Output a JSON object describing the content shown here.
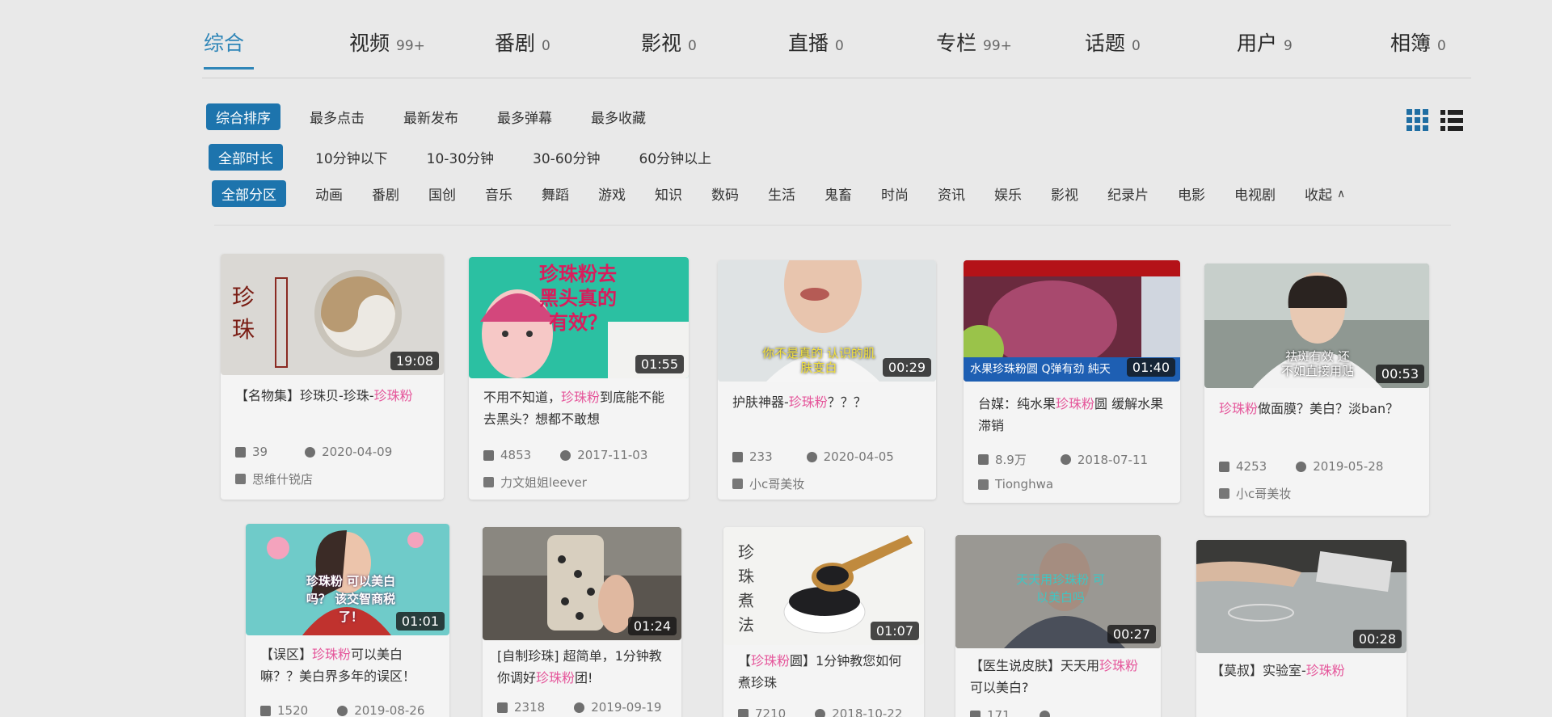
{
  "tabs": [
    {
      "label": "综合",
      "count": ""
    },
    {
      "label": "视频",
      "count": "99+"
    },
    {
      "label": "番剧",
      "count": "0"
    },
    {
      "label": "影视",
      "count": "0"
    },
    {
      "label": "直播",
      "count": "0"
    },
    {
      "label": "专栏",
      "count": "99+"
    },
    {
      "label": "话题",
      "count": "0"
    },
    {
      "label": "用户",
      "count": "9"
    },
    {
      "label": "相簿",
      "count": "0"
    }
  ],
  "sort": {
    "active": "综合排序",
    "options": [
      "最多点击",
      "最新发布",
      "最多弹幕",
      "最多收藏"
    ]
  },
  "duration": {
    "active": "全部时长",
    "options": [
      "10分钟以下",
      "10-30分钟",
      "30-60分钟",
      "60分钟以上"
    ]
  },
  "zone": {
    "active": "全部分区",
    "options": [
      "动画",
      "番剧",
      "国创",
      "音乐",
      "舞蹈",
      "游戏",
      "知识",
      "数码",
      "生活",
      "鬼畜",
      "时尚",
      "资讯",
      "娱乐",
      "影视",
      "纪录片",
      "电影",
      "电视剧"
    ],
    "collapse": "收起",
    "collapse_icon": "chevron-up-icon"
  },
  "view_toggle": {
    "grid_icon": "grid-view-icon",
    "list_icon": "list-view-icon"
  },
  "highlight_color": "#e5559a",
  "accent_color": "#1d74ad",
  "videos": [
    {
      "title_pre": "【名物集】珍珠贝-珍珠-",
      "title_hl": "珍珠粉",
      "title_post": "",
      "duration": "19:08",
      "plays": "39",
      "date": "2020-04-09",
      "author": "思维什锐店",
      "thumb_text": "珍 珠"
    },
    {
      "title_pre": "不用不知道，",
      "title_hl": "珍珠粉",
      "title_post": "到底能不能去黑头？想都不敢想",
      "duration": "01:55",
      "plays": "4853",
      "date": "2017-11-03",
      "author": "力文姐姐leever",
      "thumb_text": "珍珠粉去黑头真的有效？"
    },
    {
      "title_pre": "护肤神器-",
      "title_hl": "珍珠粉",
      "title_post": "？？？",
      "duration": "00:29",
      "plays": "233",
      "date": "2020-04-05",
      "author": "小c哥美妆",
      "thumb_text": "你不是真的 认识的肌肤变白"
    },
    {
      "title_pre": "台媒：纯水果",
      "title_hl": "珍珠粉",
      "title_post": "圆 缓解水果滞销",
      "duration": "01:40",
      "plays": "8.9万",
      "date": "2018-07-11",
      "author": "Tionghwa",
      "thumb_text": "水果珍珠粉圆 Q弹有劲 純天"
    },
    {
      "title_pre": "",
      "title_hl": "珍珠粉",
      "title_post": "做面膜？美白？淡ban？",
      "duration": "00:53",
      "plays": "4253",
      "date": "2019-05-28",
      "author": "小c哥美妆",
      "thumb_text": "祛斑有效 还不如直接用贴"
    },
    {
      "title_pre": "【误区】",
      "title_hl": "珍珠粉",
      "title_post": "可以美白嘛？？美白界多年的误区！",
      "duration": "01:01",
      "plays": "1520",
      "date": "2019-08-26",
      "author": "",
      "thumb_text": "珍珠粉 可以美白吗？ 该交智商税了！"
    },
    {
      "title_pre": "[自制珍珠] 超简单，1分钟教你调好",
      "title_hl": "珍珠粉",
      "title_post": "团!",
      "duration": "01:24",
      "plays": "2318",
      "date": "2019-09-19",
      "author": "",
      "thumb_text": ""
    },
    {
      "title_pre": "【",
      "title_hl": "珍珠粉",
      "title_post": "圆】1分钟教您如何煮珍珠",
      "duration": "01:07",
      "plays": "7210",
      "date": "2018-10-22",
      "author": "",
      "thumb_text": "珍 珠 煮 法"
    },
    {
      "title_pre": "【医生说皮肤】天天用",
      "title_hl": "珍珠粉",
      "title_post": "可以美白?",
      "duration": "00:27",
      "plays": "171",
      "date": "",
      "author": "",
      "thumb_text": "天天用珍珠粉 可以美白吗"
    },
    {
      "title_pre": "【莫叔】实验室-",
      "title_hl": "珍珠粉",
      "title_post": "",
      "duration": "00:28",
      "plays": "",
      "date": "",
      "author": "",
      "thumb_text": ""
    }
  ]
}
